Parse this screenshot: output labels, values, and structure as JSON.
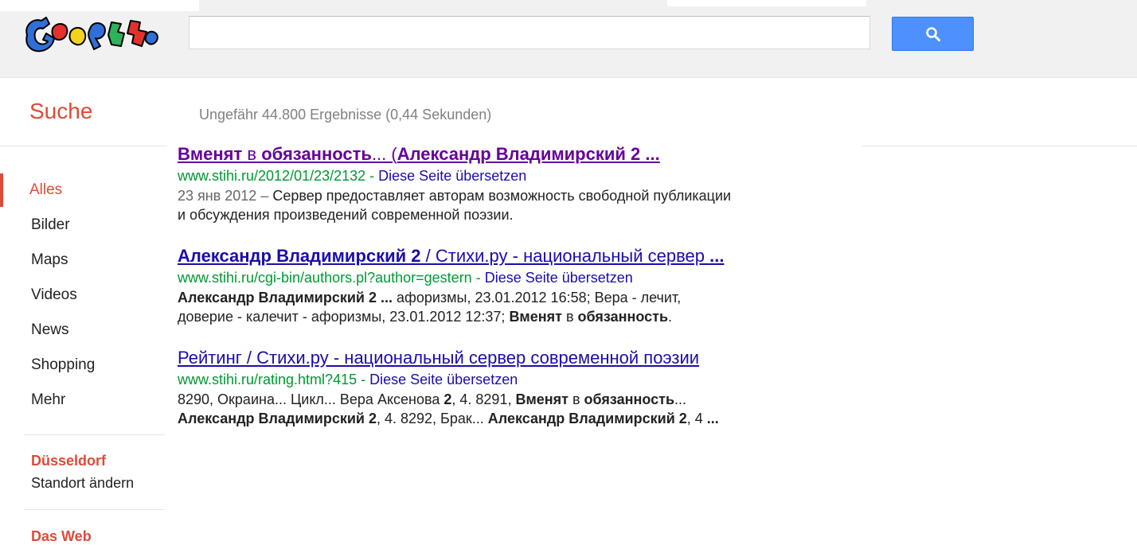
{
  "search": {
    "query": "",
    "placeholder": ""
  },
  "sidebar": {
    "title": "Suche",
    "items": [
      {
        "label": "Alles",
        "active": true
      },
      {
        "label": "Bilder"
      },
      {
        "label": "Maps"
      },
      {
        "label": "Videos"
      },
      {
        "label": "News"
      },
      {
        "label": "Shopping"
      },
      {
        "label": "Mehr"
      }
    ],
    "location": {
      "city": "Düsseldorf",
      "change_label": "Standort ändern"
    },
    "section_title": "Das Web"
  },
  "results_stats": "Ungefähr 44.800 Ergebnisse (0,44 Sekunden)",
  "results": [
    {
      "title_parts": [
        {
          "t": "Вменят",
          "b": true
        },
        {
          "t": " в ",
          "b": false
        },
        {
          "t": "обязанность",
          "b": true
        },
        {
          "t": "... (",
          "b": false
        },
        {
          "t": "Александр Владимирский 2 ...",
          "b": true
        }
      ],
      "url": "www.stihi.ru/2012/01/23/2132",
      "sep": " - ",
      "translate": "Diese Seite übersetzen",
      "date": "23 янв 2012 –",
      "snippet_lines": [
        [
          {
            "t": " Сервер предоставляет авторам возможность свободной публикации",
            "b": false
          }
        ],
        [
          {
            "t": "и обсуждения произведений современной поэзии.",
            "b": false
          }
        ]
      ]
    },
    {
      "title_parts": [
        {
          "t": "Александр Владимирский 2",
          "b": true
        },
        {
          "t": " / Стихи.ру - национальный сервер ",
          "b": false
        },
        {
          "t": "...",
          "b": true
        }
      ],
      "url": "www.stihi.ru/cgi-bin/authors.pl?author=gestern",
      "sep": " - ",
      "translate": "Diese Seite übersetzen",
      "date": "",
      "snippet_lines": [
        [
          {
            "t": "Александр Владимирский 2 ...",
            "b": true
          },
          {
            "t": " афоризмы, 23.01.2012 16:58; Вера - лечит,",
            "b": false
          }
        ],
        [
          {
            "t": "доверие - калечит - афоризмы, 23.01.2012 12:37; ",
            "b": false
          },
          {
            "t": "Вменят",
            "b": true
          },
          {
            "t": " в ",
            "b": false
          },
          {
            "t": "обязанность",
            "b": true
          },
          {
            "t": ".",
            "b": false
          }
        ]
      ]
    },
    {
      "title_parts": [
        {
          "t": "Рейтинг / Стихи.ру - национальный сервер современной поэзии",
          "b": false
        }
      ],
      "url": "www.stihi.ru/rating.html?415",
      "sep": " - ",
      "translate": "Diese Seite übersetzen",
      "date": "",
      "snippet_lines": [
        [
          {
            "t": "8290, Окраина... Цикл... Вера Аксенова ",
            "b": false
          },
          {
            "t": "2",
            "b": true
          },
          {
            "t": ", 4. 8291, ",
            "b": false
          },
          {
            "t": "Вменят",
            "b": true
          },
          {
            "t": " в ",
            "b": false
          },
          {
            "t": "обязанность",
            "b": true
          },
          {
            "t": "...",
            "b": false
          }
        ],
        [
          {
            "t": "Александр Владимирский 2",
            "b": true
          },
          {
            "t": ", 4. 8292, Брак... ",
            "b": false
          },
          {
            "t": "Александр Владимирский 2",
            "b": true
          },
          {
            "t": ", 4 ",
            "b": false
          },
          {
            "t": "...",
            "b": true
          }
        ]
      ]
    }
  ],
  "colors": {
    "accent_red": "#dd4b39",
    "link": "#1a0dab",
    "visited": "#660099",
    "url_green": "#009933",
    "button_blue": "#4d90fe"
  }
}
